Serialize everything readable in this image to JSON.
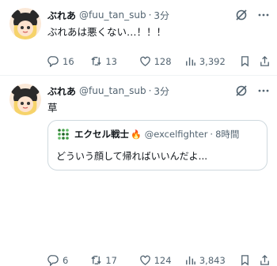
{
  "tweets": [
    {
      "name": "ぶれあ",
      "handle": "@fuu_tan_sub",
      "sep": "·",
      "time": "3分",
      "text": "ぶれあは悪くない…！！！",
      "replies": "16",
      "retweets": "13",
      "likes": "128",
      "views": "3,392"
    },
    {
      "name": "ぶれあ",
      "handle": "@fuu_tan_sub",
      "sep": "·",
      "time": "3分",
      "text": "草",
      "quote": {
        "name": "エクセル戦士",
        "handle": "@excelfighter",
        "sep": "·",
        "time": "8時間",
        "text": "どういう顔して帰ればいいんだよ..."
      },
      "replies": "6",
      "retweets": "17",
      "likes": "124",
      "views": "3,843"
    }
  ],
  "colors": {
    "text": "#0f1419",
    "muted": "#536471",
    "border": "#cfd9de"
  }
}
